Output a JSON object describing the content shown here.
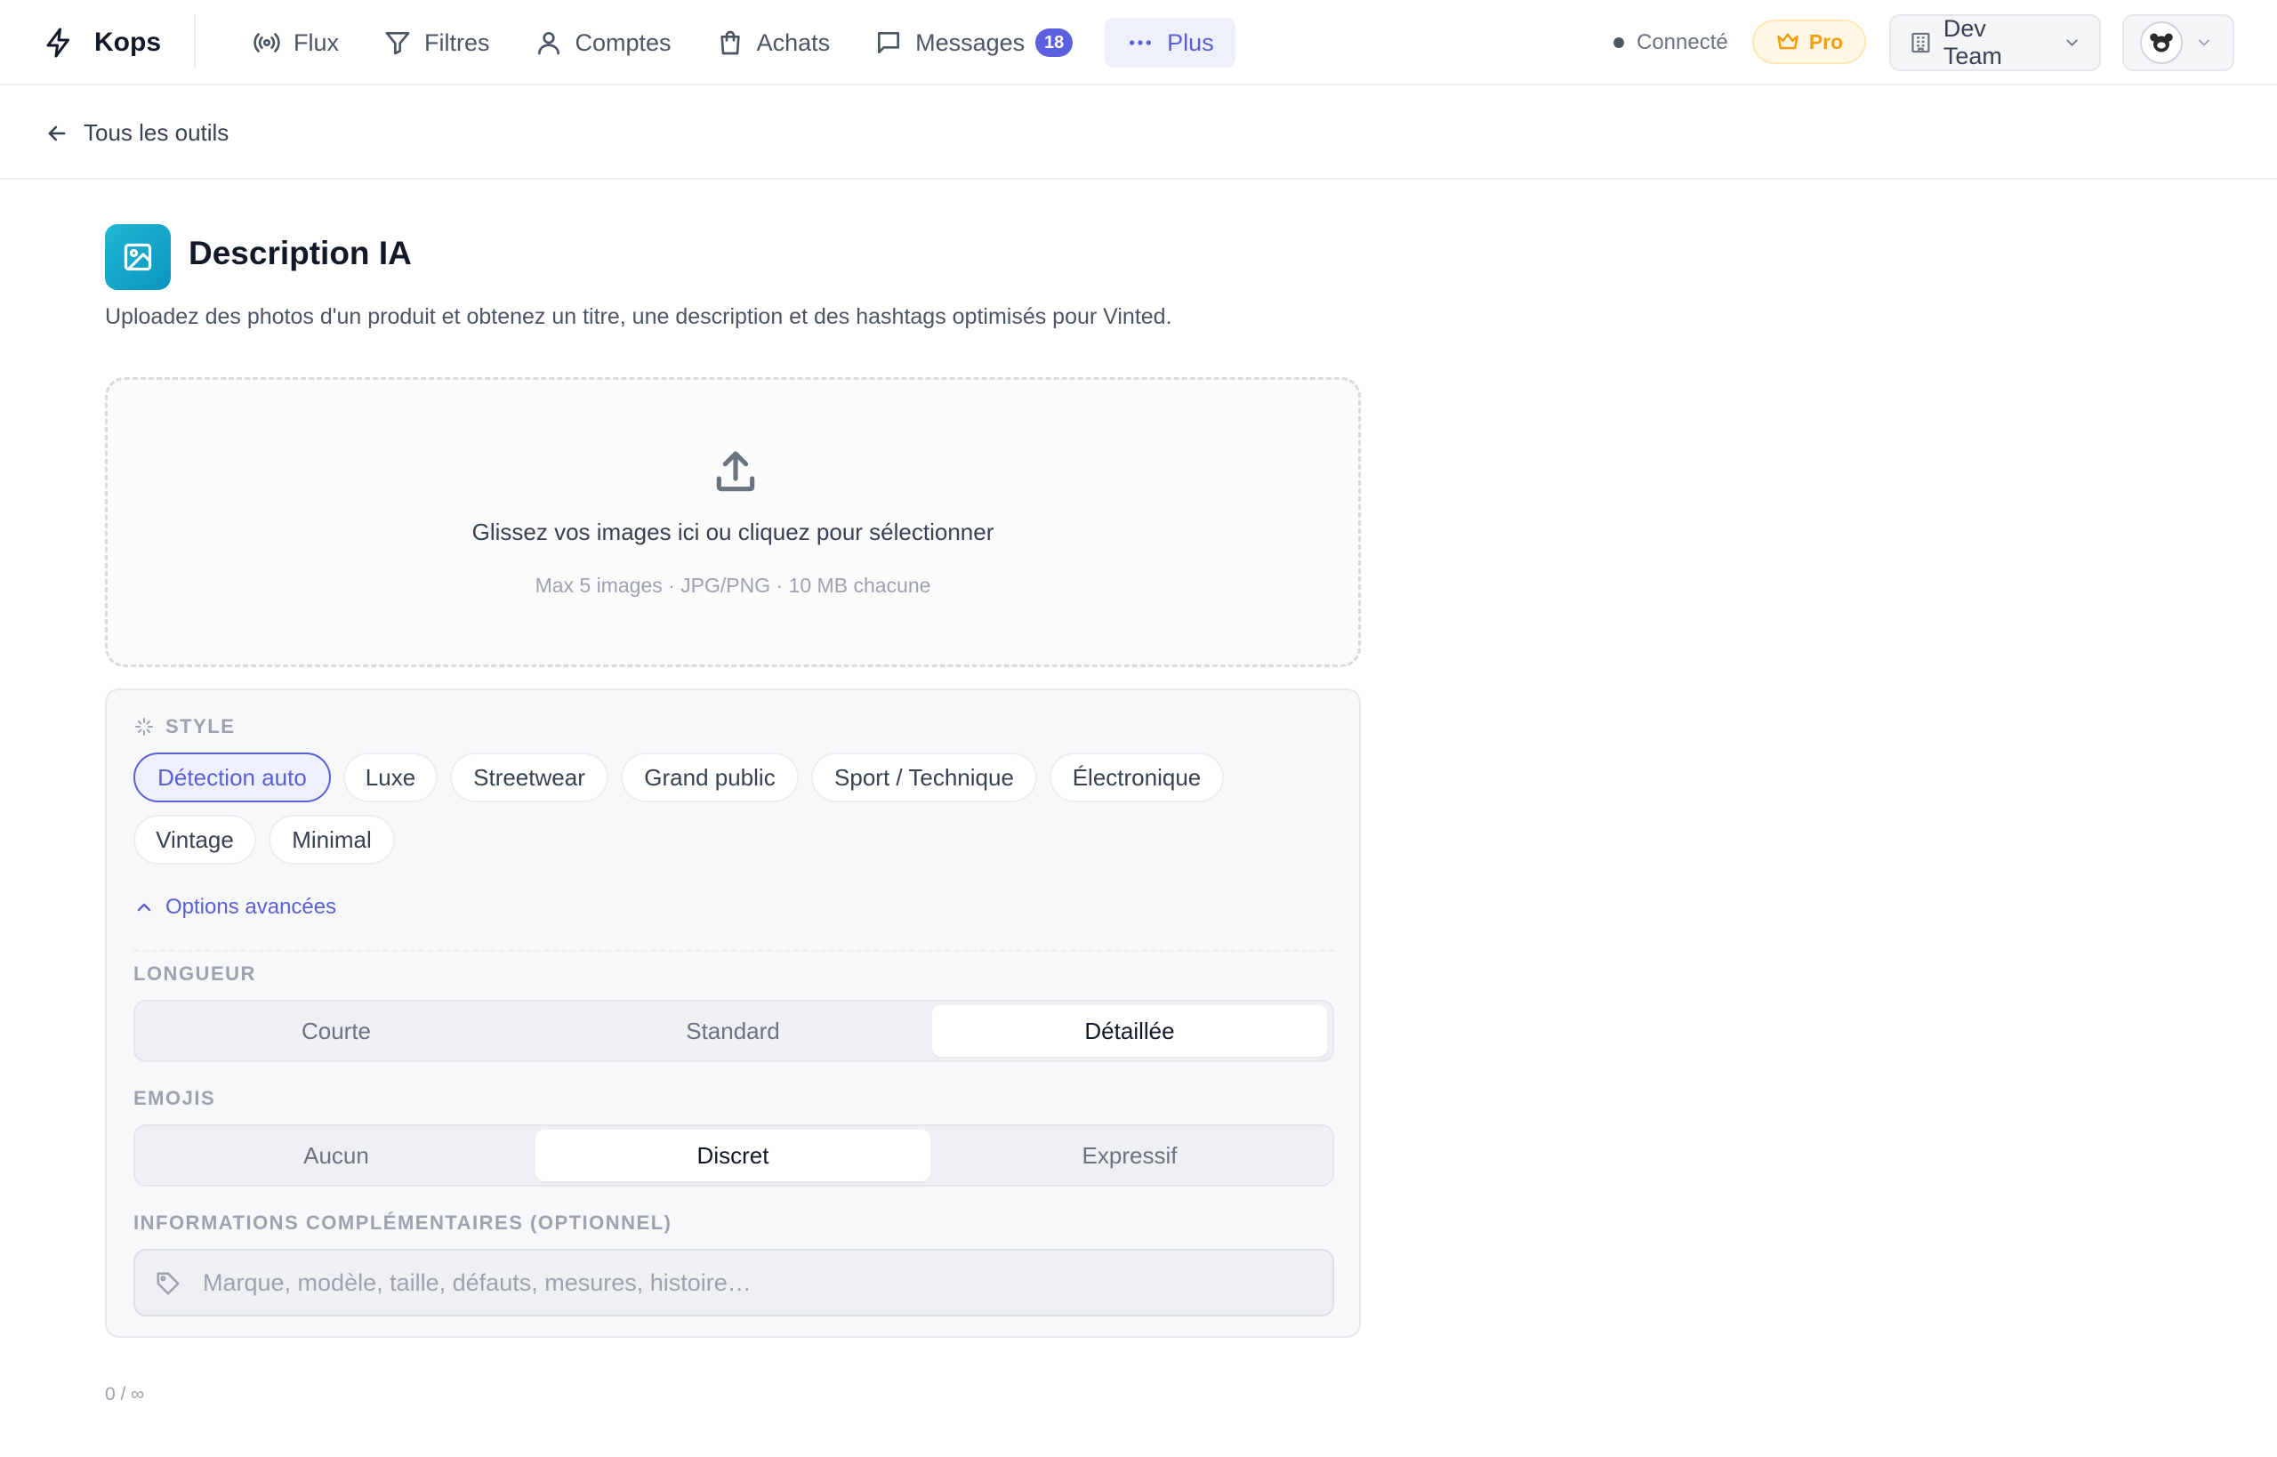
{
  "brand": {
    "name": "Kops"
  },
  "nav": {
    "items": [
      {
        "label": "Flux",
        "icon": "broadcast-icon"
      },
      {
        "label": "Filtres",
        "icon": "filter-icon"
      },
      {
        "label": "Comptes",
        "icon": "user-icon"
      },
      {
        "label": "Achats",
        "icon": "shopping-bag-icon"
      },
      {
        "label": "Messages",
        "icon": "message-icon",
        "badge": "18"
      },
      {
        "label": "Plus",
        "icon": "more-horizontal-icon",
        "active": true
      }
    ]
  },
  "status": {
    "label": "Connecté"
  },
  "plan": {
    "label": "Pro",
    "icon": "crown-icon",
    "color": "#f59e0b"
  },
  "team": {
    "label": "Dev Team"
  },
  "subheader": {
    "back_label": "Tous les outils"
  },
  "page": {
    "title": "Description IA",
    "description": "Uploadez des photos d'un produit et obtenez un titre, une description et des hashtags optimisés pour Vinted.",
    "icon_color": "#0ea5c9"
  },
  "dropzone": {
    "main_text": "Glissez vos images ici ou cliquez pour sélectionner",
    "sub_text": "Max 5 images · JPG/PNG · 10 MB chacune"
  },
  "style": {
    "label": "STYLE",
    "options": [
      "Détection auto",
      "Luxe",
      "Streetwear",
      "Grand public",
      "Sport / Technique",
      "Électronique",
      "Vintage",
      "Minimal"
    ],
    "selected": "Détection auto"
  },
  "advanced": {
    "toggle_label": "Options avancées"
  },
  "length": {
    "label": "LONGUEUR",
    "options": [
      "Courte",
      "Standard",
      "Détaillée"
    ],
    "selected": "Détaillée"
  },
  "emojis": {
    "label": "EMOJIS",
    "options": [
      "Aucun",
      "Discret",
      "Expressif"
    ],
    "selected": "Discret"
  },
  "extra_info": {
    "label": "INFORMATIONS COMPLÉMENTAIRES (OPTIONNEL)",
    "placeholder": "Marque, modèle, taille, défauts, mesures, histoire…",
    "value": ""
  },
  "counter": {
    "text": "0 / ∞"
  },
  "colors": {
    "accent": "#5b5fd6",
    "badge": "#5b5fe0"
  }
}
